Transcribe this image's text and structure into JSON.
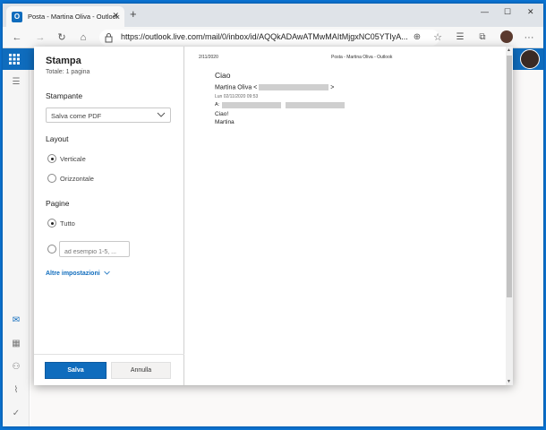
{
  "browser": {
    "tab_title": "Posta - Martina Oliva - Outlook",
    "tab_close": "✕",
    "new_tab": "+",
    "window_controls": {
      "minimize": "—",
      "maximize": "☐",
      "close": "✕"
    },
    "url": "https://outlook.live.com/mail/0/inbox/id/AQQkADAwATMwMAItMjgxNC05YTIyA...",
    "nav": {
      "back": "←",
      "forward": "→",
      "reload": "↻",
      "home": "⌂",
      "favorites": "☆",
      "more": "···"
    }
  },
  "outlook": {
    "brand_color": "#0f6cbd",
    "left_rail_icons": [
      "mail-icon",
      "calendar-icon",
      "people-icon",
      "attach-icon",
      "todo-icon"
    ]
  },
  "print_dialog": {
    "title": "Stampa",
    "subtitle": "Totale: 1 pagina",
    "printer": {
      "label": "Stampante",
      "selected": "Salva come PDF"
    },
    "layout": {
      "label": "Layout",
      "options": [
        "Verticale",
        "Orizzontale"
      ],
      "selected": "Verticale"
    },
    "pages": {
      "label": "Pagine",
      "all_label": "Tutto",
      "range_placeholder": "ad esempio 1-5, ..."
    },
    "more_settings": "Altre impostazioni",
    "save_button": "Salva",
    "cancel_button": "Annulla"
  },
  "preview": {
    "date": "2/11/2020",
    "header": "Posta - Martina Oliva - Outlook",
    "subject": "Ciao",
    "sender_name": "Martina Oliva <",
    "sender_close": ">",
    "sent_date": "Lun 02/11/2020 09:53",
    "to_label": "A:",
    "body_line1": "Ciao!",
    "body_line2": "Martina"
  }
}
